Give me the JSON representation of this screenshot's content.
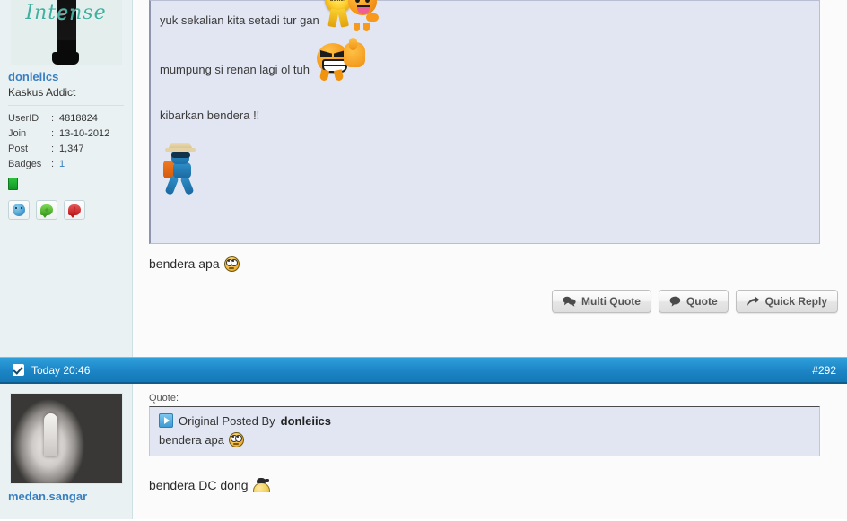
{
  "post_top": {
    "sidebar": {
      "avatar_name": "avatar-intense",
      "avatar_caption": "Intense",
      "username": "donleiics",
      "usertitle": "Kaskus Addict",
      "meta": [
        {
          "key": "UserID",
          "sep": ":",
          "value": "4818824"
        },
        {
          "key": "Join",
          "sep": ":",
          "value": "13-10-2012"
        },
        {
          "key": "Post",
          "sep": ":",
          "value": "1,347"
        },
        {
          "key": "Badges",
          "sep": ":",
          "value": "1",
          "is_link": true
        }
      ],
      "buttons": [
        {
          "name": "profile-smiley-button",
          "icon": "smiley-icon"
        },
        {
          "name": "add-reputation-button",
          "icon": "green-plus-bubble-icon"
        },
        {
          "name": "report-post-button",
          "icon": "red-exclamation-bubble-icon"
        }
      ]
    },
    "quote_lines": [
      {
        "text": "yuk sekalian kita setadi tur gan",
        "emoticon": "seller-smiley"
      },
      {
        "text": "mumpung si renan lagi ol tuh",
        "emoticon": "thumbs-up-grin"
      },
      {
        "text": "kibarkan bendera !!",
        "emoticon": ""
      },
      {
        "text": "",
        "emoticon": "traveler"
      }
    ],
    "message": {
      "text": "bendera apa",
      "emoticon": "rolling-eyes"
    },
    "footer_buttons": [
      {
        "label": "Multi Quote",
        "icon": "multi-quote-icon"
      },
      {
        "label": "Quote",
        "icon": "quote-bubble-icon"
      },
      {
        "label": "Quick Reply",
        "icon": "reply-arrow-icon"
      }
    ]
  },
  "post_bar": {
    "checkbox_icon": "checkbox-checked-icon",
    "timestamp": "Today 20:46",
    "post_number": "#292"
  },
  "post_bottom": {
    "sidebar": {
      "avatar_name": "avatar-photo",
      "username": "medan.sangar"
    },
    "quote_label": "Quote:",
    "quote": {
      "header_prefix": "Original Posted By",
      "header_author": "donleiics",
      "body_text": "bendera apa",
      "body_emoticon": "rolling-eyes",
      "icon": "quote-arrow-icon"
    },
    "message": {
      "text": "bendera DC dong",
      "emoticon": "cut-smiley"
    }
  },
  "colors": {
    "accent_blue": "#1d86c6",
    "link_blue": "#3a7fbf",
    "sidebar_bg": "#e9f1f3",
    "quote_bg": "#e2e6f2"
  }
}
